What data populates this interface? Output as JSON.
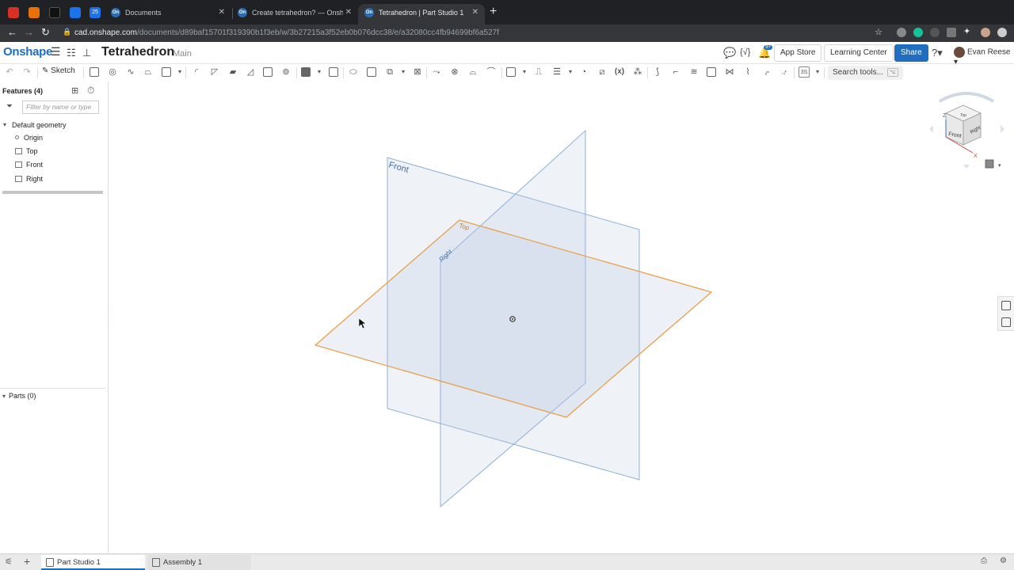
{
  "browser": {
    "tabs": [
      {
        "title": "Documents",
        "active": false
      },
      {
        "title": "Create tetrahedron? — Onshap",
        "active": false
      },
      {
        "title": "Tetrahedron | Part Studio 1",
        "active": true
      }
    ],
    "tab_favicon": "On",
    "calendar_badge": "25",
    "url_host": "cad.onshape.com",
    "url_path": "/documents/d89baf15701f319390b1f3eb/w/3b27215a3f52eb0b076dcc38/e/a32080cc4fb94699bf6a527f"
  },
  "app": {
    "logo": "Onshape",
    "document_title": "Tetrahedron",
    "branch": "Main",
    "buttons": {
      "app_store": "App Store",
      "learning_center": "Learning Center",
      "share": "Share"
    },
    "notification_badge": "9+",
    "user_name": "Evan Reese",
    "accent_color": "#1f6ebf"
  },
  "toolbar": {
    "sketch_label": "Sketch",
    "search_label": "Search tools...",
    "search_shortcut": [
      "⌥",
      "C"
    ]
  },
  "features": {
    "header": "Features (4)",
    "filter_placeholder": "Filter by name or type",
    "default_geometry_label": "Default geometry",
    "items": [
      "Origin",
      "Top",
      "Front",
      "Right"
    ],
    "parts_label": "Parts (0)"
  },
  "viewport": {
    "plane_labels": {
      "front": "Front",
      "top": "Top",
      "right": "Right"
    },
    "view_cube": {
      "top": "Top",
      "front": "Front",
      "right": "Right",
      "z_axis": "Z",
      "x_axis": "X"
    },
    "plane_color": "#6a96c9",
    "top_plane_color": "#e8a04a"
  },
  "bottom_tabs": [
    {
      "label": "Part Studio 1",
      "active": true
    },
    {
      "label": "Assembly 1",
      "active": false
    }
  ]
}
